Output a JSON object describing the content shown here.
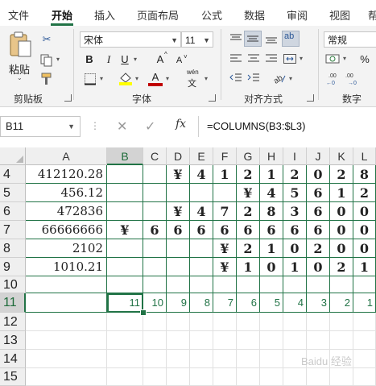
{
  "ribbon_tabs": [
    "文件",
    "开始",
    "插入",
    "页面布局",
    "公式",
    "数据",
    "审阅",
    "视图",
    "帮"
  ],
  "active_tab": "开始",
  "clipboard": {
    "paste_label": "粘贴",
    "group_label": "剪贴板"
  },
  "font": {
    "name": "宋体",
    "size": "11",
    "group_label": "字体",
    "grow_label": "A",
    "shrink_label": "A",
    "bold": "B",
    "italic": "I",
    "underline": "U",
    "font_color_label": "A",
    "phonetic_top": "wén",
    "phonetic_bottom": "文"
  },
  "alignment": {
    "group_label": "对齐方式",
    "wrap_label": "ab"
  },
  "number": {
    "format": "常规",
    "group_label": "数字"
  },
  "name_box": "B11",
  "formula_bar": {
    "fx": "fx",
    "formula": "=COLUMNS(B3:$L3)"
  },
  "colors": {
    "accent": "#217346",
    "font_color_bar": "#c00000",
    "highlight_bar": "#ffff00"
  },
  "columns": [
    "A",
    "B",
    "C",
    "D",
    "E",
    "F",
    "G",
    "H",
    "I",
    "J",
    "K",
    "L"
  ],
  "selected_column": "B",
  "row_numbers": [
    "4",
    "5",
    "6",
    "7",
    "8",
    "9",
    "10",
    "11",
    "12",
    "13",
    "14",
    "15"
  ],
  "selected_row": "11",
  "rows": [
    {
      "a": "412120.28",
      "cells": [
        "",
        "",
        "¥",
        "4",
        "1",
        "2",
        "1",
        "2",
        "0",
        "2",
        "8"
      ]
    },
    {
      "a": "456.12",
      "cells": [
        "",
        "",
        "",
        "",
        "",
        "¥",
        "4",
        "5",
        "6",
        "1",
        "2"
      ]
    },
    {
      "a": "472836",
      "cells": [
        "",
        "",
        "¥",
        "4",
        "7",
        "2",
        "8",
        "3",
        "6",
        "0",
        "0"
      ]
    },
    {
      "a": "66666666",
      "cells": [
        "¥",
        "6",
        "6",
        "6",
        "6",
        "6",
        "6",
        "6",
        "6",
        "0",
        "0"
      ]
    },
    {
      "a": "2102",
      "cells": [
        "",
        "",
        "",
        "",
        "¥",
        "2",
        "1",
        "0",
        "2",
        "0",
        "0"
      ]
    },
    {
      "a": "1010.21",
      "cells": [
        "",
        "",
        "",
        "",
        "¥",
        "1",
        "0",
        "1",
        "0",
        "2",
        "1"
      ]
    }
  ],
  "row11_results": [
    "11",
    "10",
    "9",
    "8",
    "7",
    "6",
    "5",
    "4",
    "3",
    "2",
    "1"
  ],
  "watermark": "Baidu 经验"
}
